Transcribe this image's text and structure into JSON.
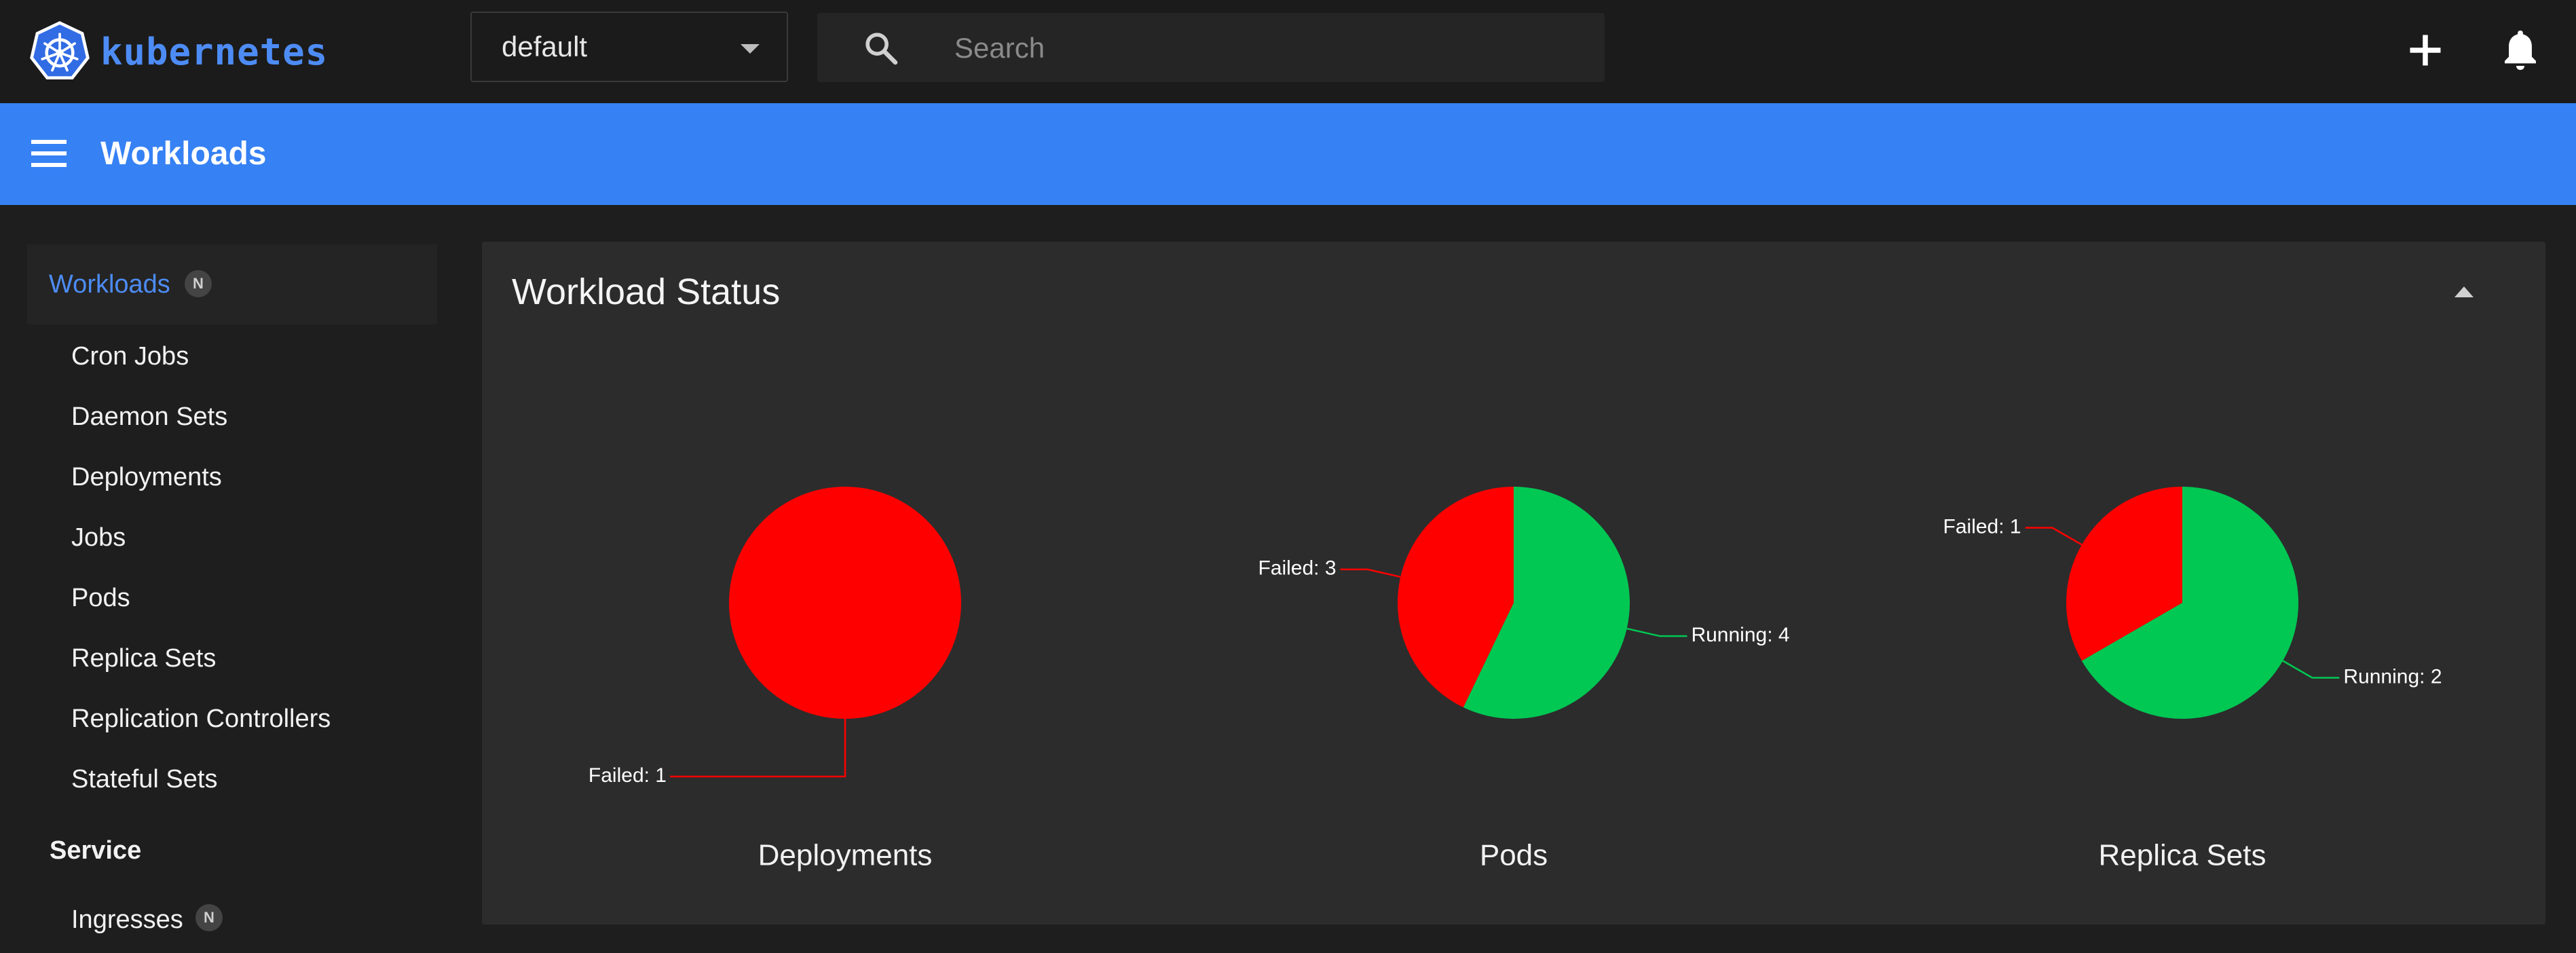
{
  "header": {
    "brand": "kubernetes",
    "namespace": "default",
    "search_placeholder": "Search"
  },
  "appbar": {
    "title": "Workloads"
  },
  "sidebar": {
    "active": {
      "label": "Workloads",
      "badge": "N"
    },
    "items": [
      {
        "label": "Cron Jobs"
      },
      {
        "label": "Daemon Sets"
      },
      {
        "label": "Deployments"
      },
      {
        "label": "Jobs"
      },
      {
        "label": "Pods"
      },
      {
        "label": "Replica Sets"
      },
      {
        "label": "Replication Controllers"
      },
      {
        "label": "Stateful Sets"
      }
    ],
    "section": "Service",
    "section_items": [
      {
        "label": "Ingresses",
        "badge": "N"
      }
    ]
  },
  "card": {
    "title": "Workload Status"
  },
  "colors": {
    "accent": "#3681f4",
    "failed": "#ff0000",
    "running": "#00c853"
  },
  "chart_data": [
    {
      "type": "pie",
      "title": "Deployments",
      "slices": [
        {
          "label": "Failed",
          "value": 1,
          "color": "#ff0000"
        }
      ]
    },
    {
      "type": "pie",
      "title": "Pods",
      "slices": [
        {
          "label": "Running",
          "value": 4,
          "color": "#00c853"
        },
        {
          "label": "Failed",
          "value": 3,
          "color": "#ff0000"
        }
      ]
    },
    {
      "type": "pie",
      "title": "Replica Sets",
      "slices": [
        {
          "label": "Running",
          "value": 2,
          "color": "#00c853"
        },
        {
          "label": "Failed",
          "value": 1,
          "color": "#ff0000"
        }
      ]
    }
  ]
}
